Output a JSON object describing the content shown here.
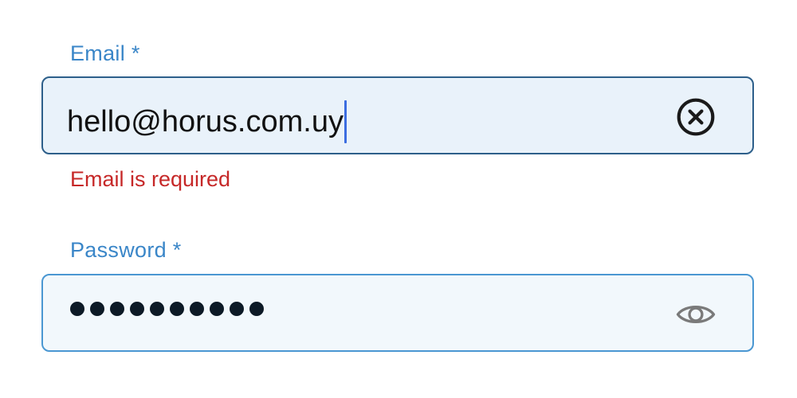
{
  "email": {
    "label": "Email *",
    "value": "hello@horus.com.uy",
    "clear_icon": "clear-circle-icon",
    "error": "Email is required",
    "error_color": "#c62828",
    "border_color": "#2d5f8a",
    "background": "#e9f2fa"
  },
  "password": {
    "label": "Password *",
    "masked_length": 10,
    "visibility_icon": "eye-icon",
    "border_color": "#4a97d2",
    "background": "#f2f8fc"
  },
  "colors": {
    "label": "#3a86c8",
    "caret": "#3b6de0"
  }
}
